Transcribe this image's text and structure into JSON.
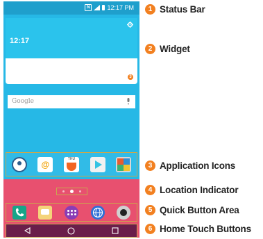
{
  "status_bar": {
    "time": "12:17 PM"
  },
  "widget": {
    "clock": "12:17",
    "badge": "3"
  },
  "search": {
    "placeholder": "Google"
  },
  "apps": {
    "calendar_day": "THU"
  },
  "callouts": [
    {
      "number": "1",
      "label": "Status Bar"
    },
    {
      "number": "2",
      "label": "Widget"
    },
    {
      "number": "3",
      "label": "Application Icons"
    },
    {
      "number": "4",
      "label": "Location Indicator"
    },
    {
      "number": "5",
      "label": "Quick Button Area"
    },
    {
      "number": "6",
      "label": "Home Touch Buttons"
    }
  ],
  "colors": {
    "screen_bg": "#26b8e6",
    "accent_orange": "#f28020",
    "pink_band": "#e8506f",
    "nav_bg": "#6a1e4a"
  }
}
